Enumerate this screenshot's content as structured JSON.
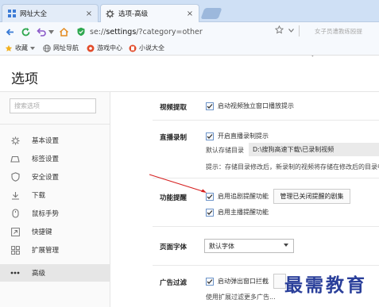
{
  "tabs": [
    {
      "title": "网址大全",
      "close": "×"
    },
    {
      "title": "选项-高级",
      "close": "×"
    }
  ],
  "nav": {
    "url_prefix": "se://",
    "url_host": "settings",
    "url_rest": "/?category=other",
    "search_hint": "女子员遭教练殴提"
  },
  "bookmarks": [
    {
      "label": "收藏",
      "icon": "star-icon"
    },
    {
      "label": "网址导航",
      "icon": "globe-icon"
    },
    {
      "label": "游戏中心",
      "icon": "game-icon"
    },
    {
      "label": "小说大全",
      "icon": "book-icon"
    }
  ],
  "page": {
    "title": "选项"
  },
  "sidebar": {
    "search_placeholder": "搜索选项",
    "items": [
      {
        "label": "基本设置",
        "icon": "gear-icon"
      },
      {
        "label": "标签设置",
        "icon": "tab-icon"
      },
      {
        "label": "安全设置",
        "icon": "shield-icon"
      },
      {
        "label": "下载",
        "icon": "download-icon"
      },
      {
        "label": "鼠标手势",
        "icon": "mouse-icon"
      },
      {
        "label": "快捷键",
        "icon": "shortcut-icon"
      },
      {
        "label": "扩展管理",
        "icon": "extension-icon"
      },
      {
        "label": "高级",
        "icon": "more-icon",
        "active": true
      }
    ]
  },
  "sections": {
    "video_extract": {
      "label": "视频提取",
      "option": "启动视频独立窗口播放提示",
      "checked": true
    },
    "live_record": {
      "label": "直播录制",
      "option": "开启直播录制提示",
      "checked": true,
      "dir_label": "默认存储目录",
      "dir_value": "D:\\搜狗高速下载\\已录制视频",
      "hint": "提示：存储目录修改后，新录制的视频将存储在修改后的目录中"
    },
    "feature_remind": {
      "label": "功能提醒",
      "option1": "启用追剧提醒功能",
      "option1_checked": true,
      "manage_button": "管理已关闭提醒的剧集",
      "option2": "启用主播提醒功能",
      "option2_checked": true
    },
    "page_font": {
      "label": "页面字体",
      "select_value": "默认字体"
    },
    "ad_filter": {
      "label": "广告过滤",
      "option": "启动弹出窗口拦截",
      "checked": true,
      "more": "使用扩展过滤更多广告..."
    }
  },
  "watermark": "最需教育"
}
